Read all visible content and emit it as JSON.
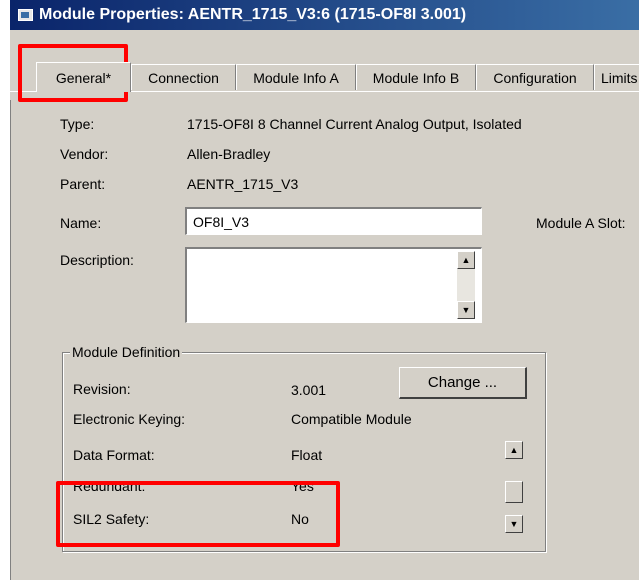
{
  "window": {
    "title": "Module Properties: AENTR_1715_V3:6 (1715-OF8I 3.001)"
  },
  "tabs": [
    {
      "label": "General*"
    },
    {
      "label": "Connection"
    },
    {
      "label": "Module Info A"
    },
    {
      "label": "Module Info B"
    },
    {
      "label": "Configuration"
    },
    {
      "label": "Limits"
    }
  ],
  "general": {
    "type_label": "Type:",
    "type_value": "1715-OF8I 8 Channel Current Analog Output, Isolated",
    "vendor_label": "Vendor:",
    "vendor_value": "Allen-Bradley",
    "parent_label": "Parent:",
    "parent_value": "AENTR_1715_V3",
    "name_label": "Name:",
    "name_value": "OF8I_V3",
    "slot_label": "Module A Slot:",
    "description_label": "Description:",
    "description_value": ""
  },
  "module_definition": {
    "title": "Module Definition",
    "change_button": "Change ...",
    "rows": [
      {
        "label": "Revision:",
        "value": "3.001"
      },
      {
        "label": "Electronic Keying:",
        "value": "Compatible Module"
      },
      {
        "label": "Data Format:",
        "value": "Float"
      },
      {
        "label": "Redundant:",
        "value": "Yes"
      },
      {
        "label": "SIL2 Safety:",
        "value": "No"
      }
    ]
  },
  "icons": {
    "scroll_up": "▲",
    "scroll_down": "▼"
  },
  "colors": {
    "titlebar_start": "#0a246a",
    "titlebar_end": "#3a6ea5",
    "highlight": "#ff0000",
    "dialog_bg": "#d4d0c8"
  }
}
